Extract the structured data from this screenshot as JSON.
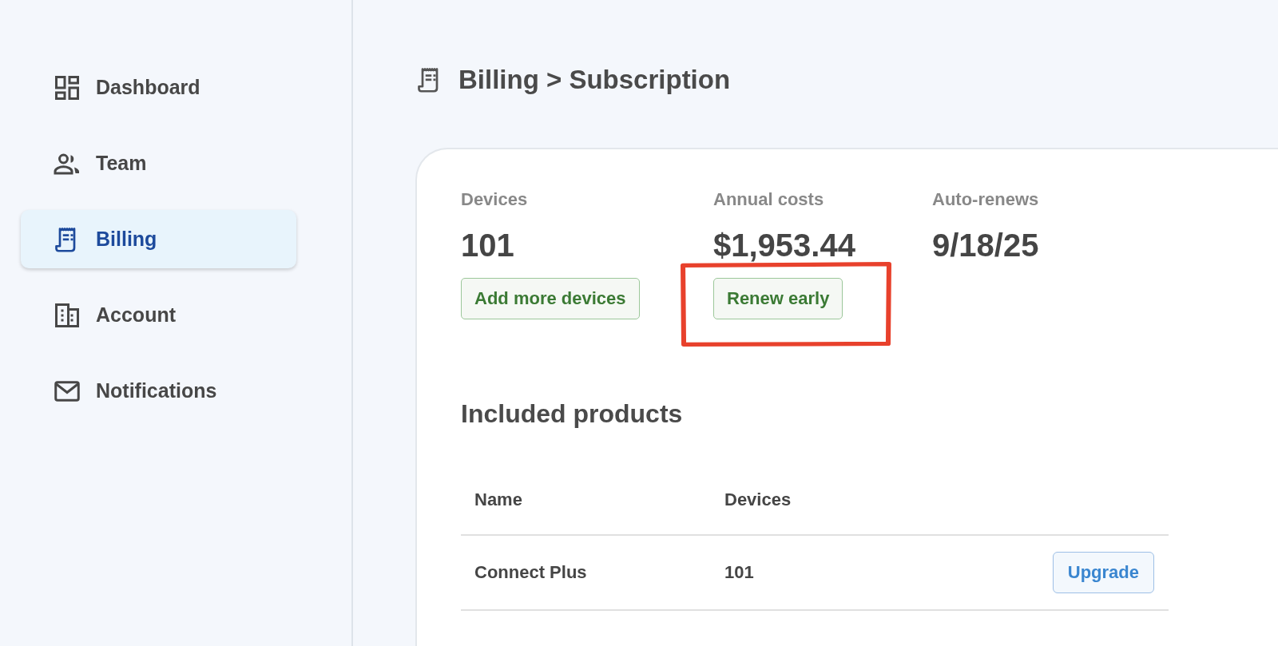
{
  "sidebar": {
    "items": [
      {
        "label": "Dashboard",
        "kind": "dashboard",
        "selected": false
      },
      {
        "label": "Team",
        "kind": "team",
        "selected": false
      },
      {
        "label": "Billing",
        "kind": "billing",
        "selected": true
      },
      {
        "label": "Account",
        "kind": "account",
        "selected": false
      },
      {
        "label": "Notifications",
        "kind": "notifications",
        "selected": false
      }
    ]
  },
  "header": {
    "kind": "billing",
    "title": "Billing > Subscription"
  },
  "stats": [
    {
      "label": "Devices",
      "value": "101",
      "button": "Add more devices",
      "highlighted": false
    },
    {
      "label": "Annual costs",
      "value": "$1,953.44",
      "button": "Renew early",
      "highlighted": true
    },
    {
      "label": "Auto-renews",
      "value": "9/18/25",
      "highlighted": false
    }
  ],
  "products": {
    "title": "Included products",
    "columns": [
      "Name",
      "Devices"
    ],
    "rows": [
      {
        "cells": [
          "Connect Plus",
          "101"
        ],
        "button": "Upgrade"
      }
    ]
  }
}
